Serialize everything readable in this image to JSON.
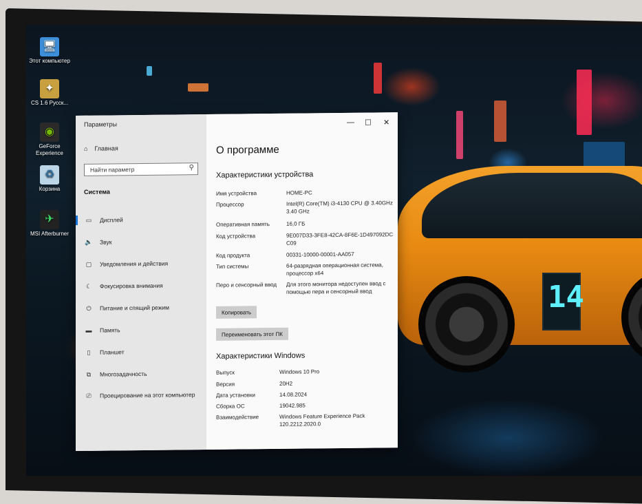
{
  "desktop": {
    "icons": [
      {
        "label": "Этот компьютер",
        "icon": "computer-icon"
      },
      {
        "label": "CS 1.6 Русск...",
        "icon": "cs-game-icon"
      },
      {
        "label": "GeForce Experience",
        "icon": "geforce-icon"
      },
      {
        "label": "Корзина",
        "icon": "recycle-bin-icon"
      },
      {
        "label": "MSI Afterburner",
        "icon": "afterburner-icon"
      }
    ]
  },
  "window": {
    "title": "Параметры",
    "controls": {
      "minimize": "—",
      "maximize": "☐",
      "close": "✕"
    },
    "sidebar": {
      "home": "Главная",
      "search_placeholder": "Найти параметр",
      "section": "Система",
      "items": [
        {
          "label": "Дисплей",
          "icon": "display-icon"
        },
        {
          "label": "Звук",
          "icon": "sound-icon"
        },
        {
          "label": "Уведомления и действия",
          "icon": "notifications-icon"
        },
        {
          "label": "Фокусировка внимания",
          "icon": "focus-assist-icon"
        },
        {
          "label": "Питание и спящий режим",
          "icon": "power-icon"
        },
        {
          "label": "Память",
          "icon": "storage-icon"
        },
        {
          "label": "Планшет",
          "icon": "tablet-icon"
        },
        {
          "label": "Многозадачность",
          "icon": "multitasking-icon"
        },
        {
          "label": "Проецирование на этот компьютер",
          "icon": "projecting-icon"
        }
      ]
    },
    "content": {
      "title": "О программе",
      "device_section": "Характеристики устройства",
      "device_specs": [
        {
          "key": "Имя устройства",
          "value": "HOME-PC"
        },
        {
          "key": "Процессор",
          "value": "Intel(R) Core(TM) i3-4130 CPU @ 3.40GHz   3.40 GHz"
        },
        {
          "key": "Оперативная память",
          "value": "16,0 ГБ"
        },
        {
          "key": "Код устройства",
          "value": "9E007D33-3FE8-42CA-8F6E-1D497092DC C09"
        },
        {
          "key": "Код продукта",
          "value": "00331-10000-00001-AA057"
        },
        {
          "key": "Тип системы",
          "value": "64-разрядная операционная система, процессор x64"
        },
        {
          "key": "Перо и сенсорный ввод",
          "value": "Для этого монитора недоступен ввод с помощью пера и сенсорный ввод"
        }
      ],
      "copy_button": "Копировать",
      "rename_button": "Переименовать этот ПК",
      "windows_section": "Характеристики Windows",
      "windows_specs": [
        {
          "key": "Выпуск",
          "value": "Windows 10 Pro"
        },
        {
          "key": "Версия",
          "value": "20H2"
        },
        {
          "key": "Дата установки",
          "value": "14.08.2024"
        },
        {
          "key": "Сборка ОС",
          "value": "19042.985"
        },
        {
          "key": "Взаимодействие",
          "value": "Windows Feature Experience Pack 120.2212.2020.0"
        }
      ]
    }
  },
  "wallpaper": {
    "car_panel_text": "14"
  }
}
